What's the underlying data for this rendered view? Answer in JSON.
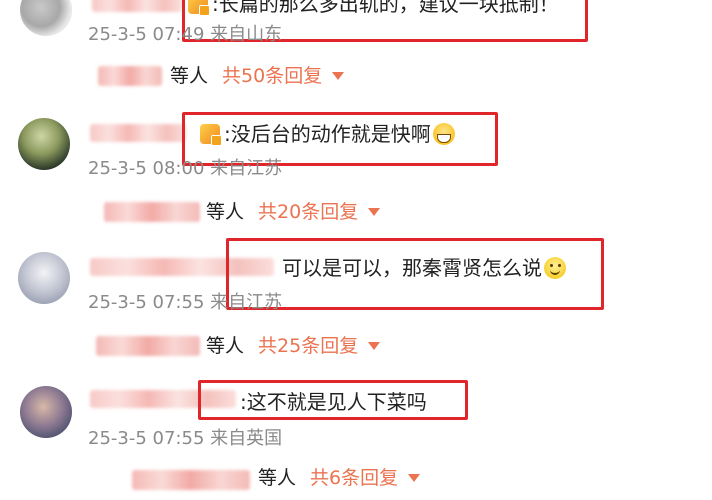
{
  "comments": [
    {
      "text": ":长篇的那么多出轨的，建议一块抵制！",
      "time": "25-3-5 07:49",
      "location": "来自山东",
      "reply_suffix": "等人",
      "reply_count": "共50条回复"
    },
    {
      "text": ":没后台的动作就是快啊",
      "time": "25-3-5 08:00",
      "location": "来自江苏",
      "reply_suffix": "等人",
      "reply_count": "共20条回复"
    },
    {
      "text": "可以是可以，那秦霄贤怎么说",
      "time": "25-3-5 07:55",
      "location": "来自江苏",
      "reply_suffix": "等人",
      "reply_count": "共25条回复"
    },
    {
      "text": ":这不就是见人下菜吗",
      "time": "25-3-5 07:55",
      "location": "来自英国",
      "reply_suffix": "等人",
      "reply_count": "共6条回复"
    }
  ],
  "icons": {
    "badge": "vip-badge-icon",
    "grin": "grin-emoji-icon",
    "smile": "smile-emoji-icon",
    "caret": "caret-down-icon"
  },
  "colors": {
    "highlight_box": "#e0262b",
    "reply_count": "#eb7350",
    "meta": "#8a8a8a"
  }
}
